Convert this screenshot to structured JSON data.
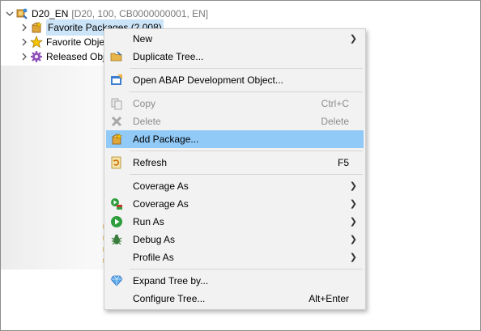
{
  "tree": {
    "root": {
      "name": "D20_EN",
      "details": "[D20, 100, CB0000000001, EN]"
    },
    "items": [
      {
        "label": "Favorite Packages",
        "suffix": "(2,008)"
      },
      {
        "label": "Favorite Obje"
      },
      {
        "label": "Released Obj"
      }
    ]
  },
  "menu": {
    "new": "New",
    "duplicate_tree": "Duplicate Tree...",
    "open_abap": "Open ABAP Development Object...",
    "copy": "Copy",
    "copy_shortcut": "Ctrl+C",
    "delete": "Delete",
    "delete_shortcut": "Delete",
    "add_package": "Add Package...",
    "refresh": "Refresh",
    "refresh_shortcut": "F5",
    "coverage_as_1": "Coverage As",
    "coverage_as_2": "Coverage As",
    "run_as": "Run As",
    "debug_as": "Debug As",
    "profile_as": "Profile As",
    "expand_tree": "Expand Tree by...",
    "configure_tree": "Configure Tree...",
    "configure_shortcut": "Alt+Enter"
  },
  "colors": {
    "highlight": "#91c9f7",
    "selection": "#cce4f7",
    "menu_bg": "#f2f2f2"
  },
  "icons": {
    "root": "system-connection-icon",
    "favorite_packages": "package-star-icon",
    "favorite_objects": "star-icon",
    "released_objects": "gear-icon"
  }
}
